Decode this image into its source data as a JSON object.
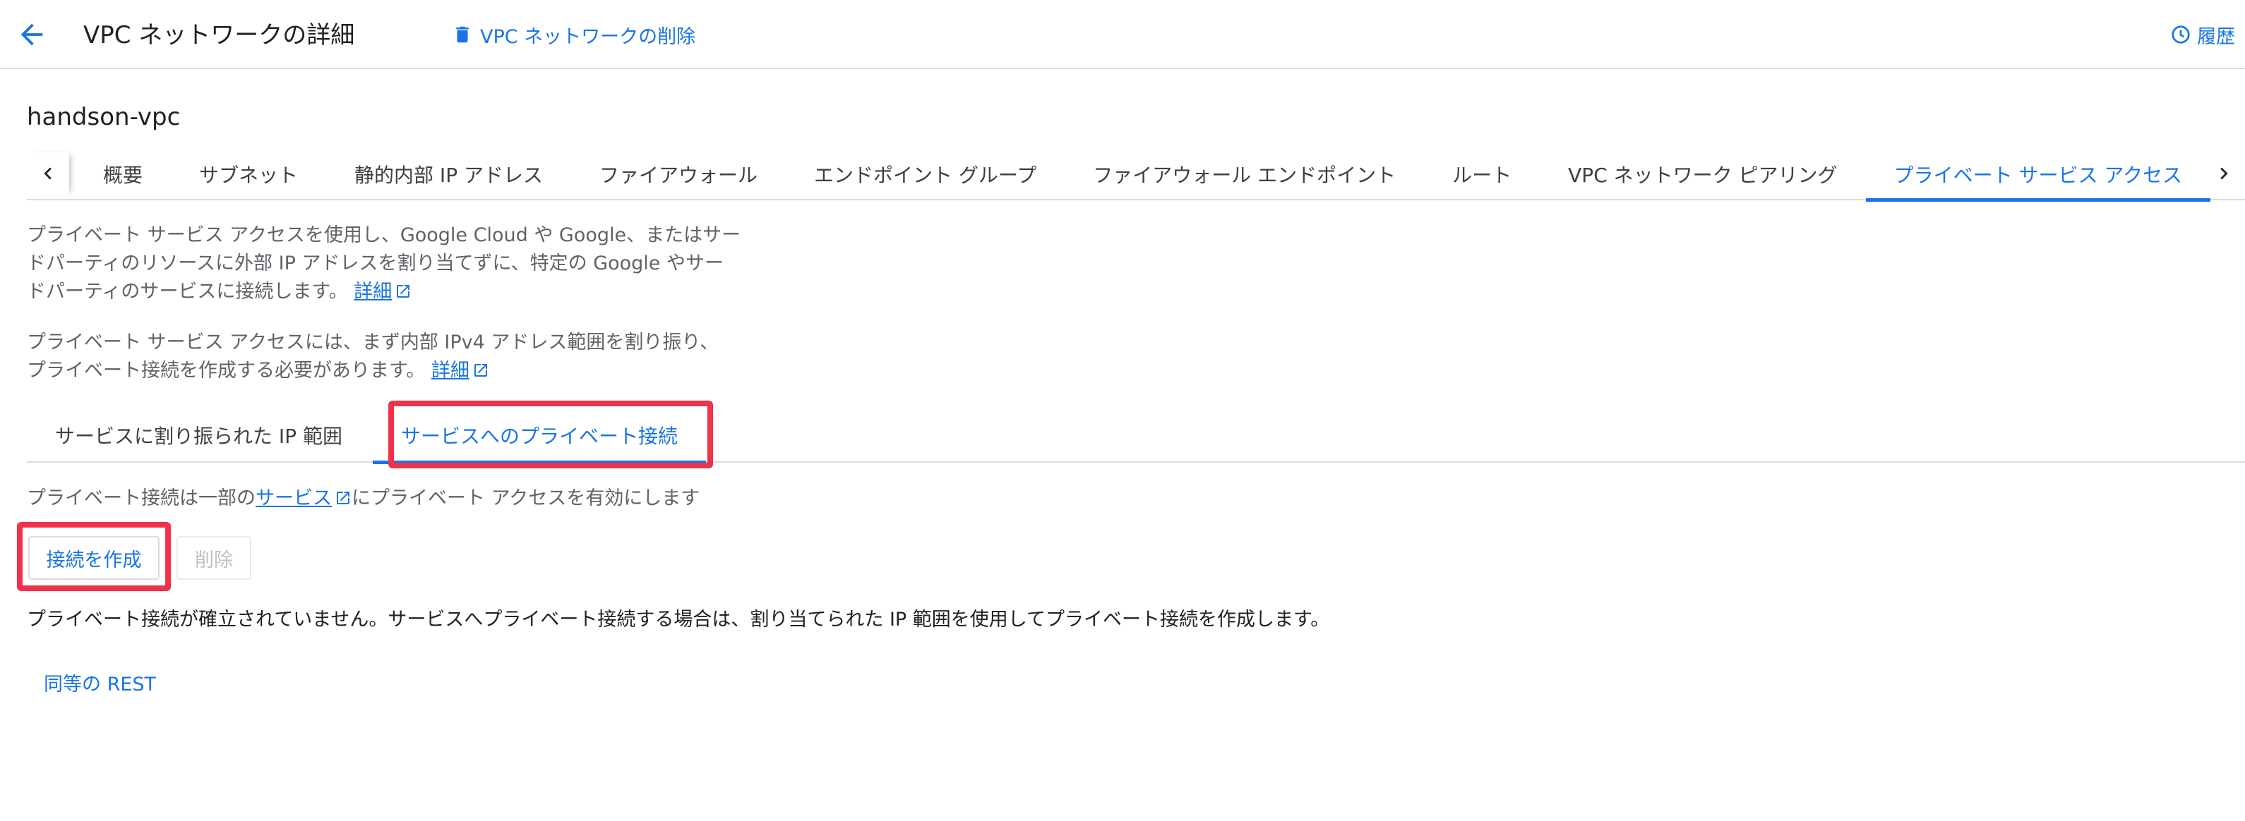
{
  "header": {
    "title": "VPC ネットワークの詳細",
    "delete_label": "VPC ネットワークの削除",
    "history_label": "履歴"
  },
  "network_name": "handson-vpc",
  "tabs": [
    {
      "label": "概要",
      "active": false
    },
    {
      "label": "サブネット",
      "active": false
    },
    {
      "label": "静的内部 IP アドレス",
      "active": false
    },
    {
      "label": "ファイアウォール",
      "active": false
    },
    {
      "label": "エンドポイント グループ",
      "active": false
    },
    {
      "label": "ファイアウォール エンドポイント",
      "active": false
    },
    {
      "label": "ルート",
      "active": false
    },
    {
      "label": "VPC ネットワーク ピアリング",
      "active": false
    },
    {
      "label": "プライベート サービス アクセス",
      "active": true
    }
  ],
  "description1": {
    "line1": "プライベート サービス アクセスを使用し、Google Cloud や Google、またはサー",
    "line2": "ドパーティのリソースに外部 IP アドレスを割り当てずに、特定の Google やサー",
    "line3": "ドパーティのサービスに接続します。",
    "link": "詳細"
  },
  "description2": {
    "line1": "プライベート サービス アクセスには、まず内部 IPv4 アドレス範囲を割り振り、",
    "line2": "プライベート接続を作成する必要があります。",
    "link": "詳細"
  },
  "subtabs": {
    "allocated": "サービスに割り振られた IP 範囲",
    "private_connections": "サービスへのプライベート接続"
  },
  "info": {
    "before": "プライベート接続は一部の",
    "link": "サービス",
    "after": "にプライベート アクセスを有効にします"
  },
  "actions": {
    "create": "接続を作成",
    "delete": "削除"
  },
  "status_message": "プライベート接続が確立されていません。サービスへプライベート接続する場合は、割り当てられた IP 範囲を使用してプライベート接続を作成します。",
  "rest_link": "同等の REST",
  "colors": {
    "accent": "#1a73e8",
    "highlight": "#f0324a"
  }
}
